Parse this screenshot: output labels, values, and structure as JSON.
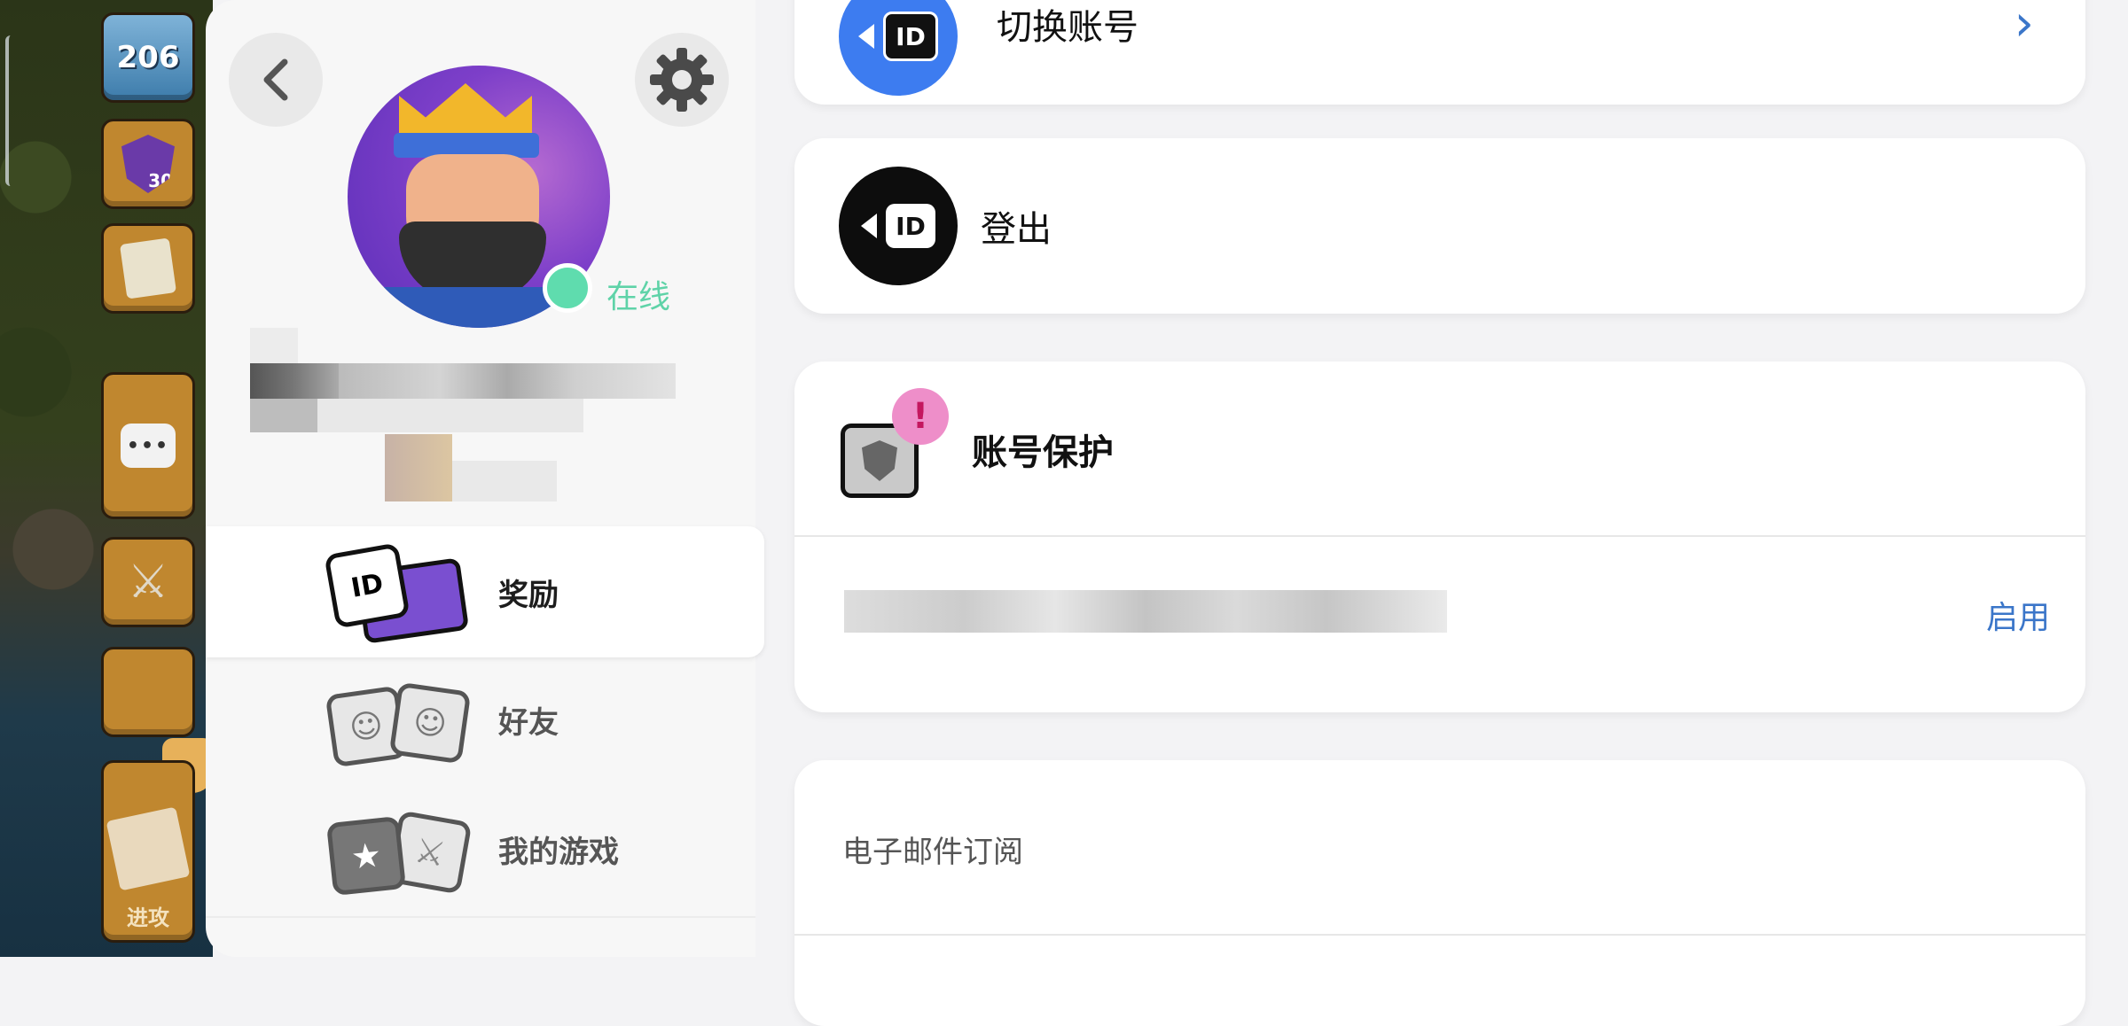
{
  "game": {
    "level": "206",
    "league_level": "30",
    "attack_label": "进攻"
  },
  "profile": {
    "status": "在线"
  },
  "nav": {
    "items": [
      {
        "label": "奖励",
        "icon": "id-cards-icon",
        "active": true
      },
      {
        "label": "好友",
        "icon": "friends-faces-icon",
        "active": false
      },
      {
        "label": "我的游戏",
        "icon": "my-games-icon",
        "active": false
      }
    ]
  },
  "account": {
    "switch_label": "切换账号",
    "logout_label": "登出",
    "protect_label": "账号保护",
    "protect_action": "启用",
    "email_label": "电子邮件订阅"
  },
  "colors": {
    "online": "#5fdcae",
    "link": "#3b76c9",
    "switch_icon_bg": "#3d7cf0",
    "alert_badge": "#ee8ec9"
  }
}
